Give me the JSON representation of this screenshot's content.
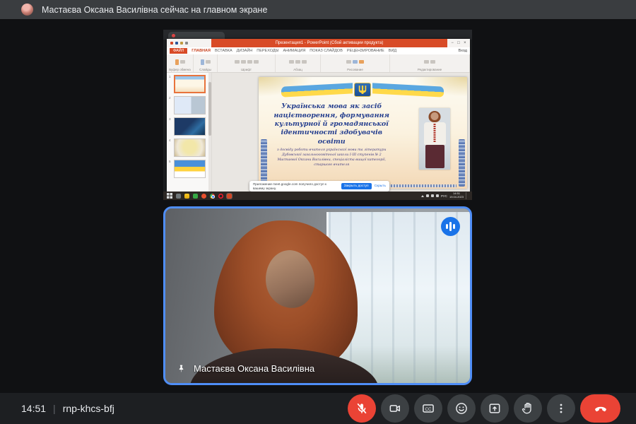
{
  "colors": {
    "accent_blue": "#1a73e8",
    "tile_border_blue": "#4f8ef7",
    "danger_red": "#ea4335",
    "powerpoint_red": "#d84b27"
  },
  "banner": {
    "text": "Мастаєва Оксана Василівна сейчас на главном экране"
  },
  "tile": {
    "name": "Мастаєва Оксана Василівна"
  },
  "footer": {
    "time": "14:51",
    "code": "rnp-khcs-bfj",
    "cc_glyph": "CC",
    "buttons": [
      "mic-off",
      "camera",
      "captions",
      "emoji-reactions",
      "present-screen",
      "raise-hand",
      "more-options",
      "end-call"
    ]
  },
  "shared_screen": {
    "powerpoint": {
      "window_title": "Презентация1 - PowerPoint (Сбой активации продукта)",
      "file_tab": "ФАЙЛ",
      "tabs": [
        "ГЛАВНАЯ",
        "ВСТАВКА",
        "ДИЗАЙН",
        "ПЕРЕХОДЫ",
        "АНИМАЦИЯ",
        "ПОКАЗ СЛАЙДОВ",
        "РЕЦЕНЗИРОВАНИЕ",
        "ВИД"
      ],
      "sign_in": "Вход",
      "win_controls": [
        "−",
        "□",
        "×"
      ],
      "groups": [
        "Буфер обмена",
        "Слайды",
        "Шрифт",
        "Абзац",
        "Рисование",
        "Редактирование"
      ],
      "slide_numbers": [
        "1",
        "2",
        "3",
        "4",
        "5"
      ],
      "slide": {
        "title": "Українська мова як засіб націєтворення, формування культурної й громадянської ідентичності здобувачів освіти",
        "subtitle": "з досвіду роботи вчителя української мови та літератури Дубовської загальноосвітньої школи І-ІІІ ступенів № 2 Мастаєвої Оксани Василівни, спеціаліста вищої категорії, старшого вчителя"
      }
    },
    "share_notification": {
      "text": "Приложение meet.google.com получило доступ к вашему экрану.",
      "stop": "Закрыть доступ",
      "hide": "Скрыть"
    },
    "taskbar": {
      "lang": "РУС",
      "time": "14:51",
      "date": "19.04.2023"
    }
  }
}
